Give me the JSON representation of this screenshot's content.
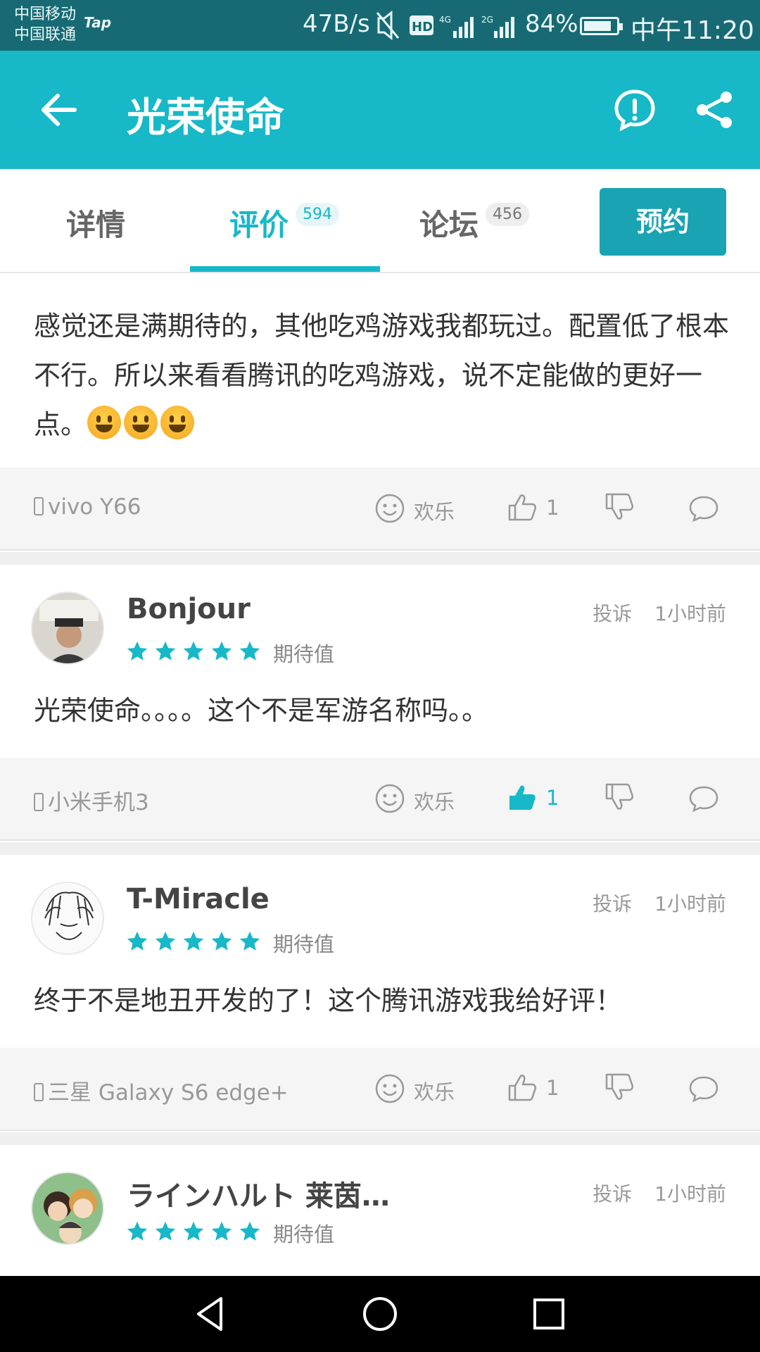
{
  "status_bar": {
    "carrier1": "中国移动",
    "carrier2": "中国联通",
    "app_badge": "Tap",
    "net_speed": "47B/s",
    "battery": "84%",
    "time": "中午11:20"
  },
  "app_bar": {
    "title": "光荣使命",
    "back_icon": "arrow-left",
    "report_icon": "exclamation-circle",
    "share_icon": "share"
  },
  "tabs": [
    {
      "label": "详情",
      "count": ""
    },
    {
      "label": "评价",
      "count": "594",
      "active": true
    },
    {
      "label": "论坛",
      "count": "456"
    }
  ],
  "reserve_button": "预约",
  "accent_color": "#17b8c7",
  "reviews": [
    {
      "text": "感觉还是满期待的，其他吃鸡游戏我都玩过。配置低了根本不行。所以来看看腾讯的吃鸡游戏，说不定能做的更好一点。",
      "emojis": 3,
      "device": "vivo Y66",
      "mood": "欢乐",
      "likes": "1",
      "liked": false
    },
    {
      "username": "Bonjour",
      "report": "投诉",
      "time": "1小时前",
      "stars": 5,
      "rating_label": "期待值",
      "text": "光荣使命。。。。这个不是军游名称吗。。",
      "device": "小米手机3",
      "mood": "欢乐",
      "likes": "1",
      "liked": true
    },
    {
      "username": "T-Miracle",
      "report": "投诉",
      "time": "1小时前",
      "stars": 5,
      "rating_label": "期待值",
      "text": "终于不是地丑开发的了！这个腾讯游戏我给好评！",
      "device": "三星 Galaxy S6 edge+",
      "mood": "欢乐",
      "likes": "1",
      "liked": false
    },
    {
      "username": "ラインハルト 莱茵…",
      "report": "投诉",
      "time": "1小时前",
      "stars": 5,
      "rating_label": "期待值"
    }
  ]
}
